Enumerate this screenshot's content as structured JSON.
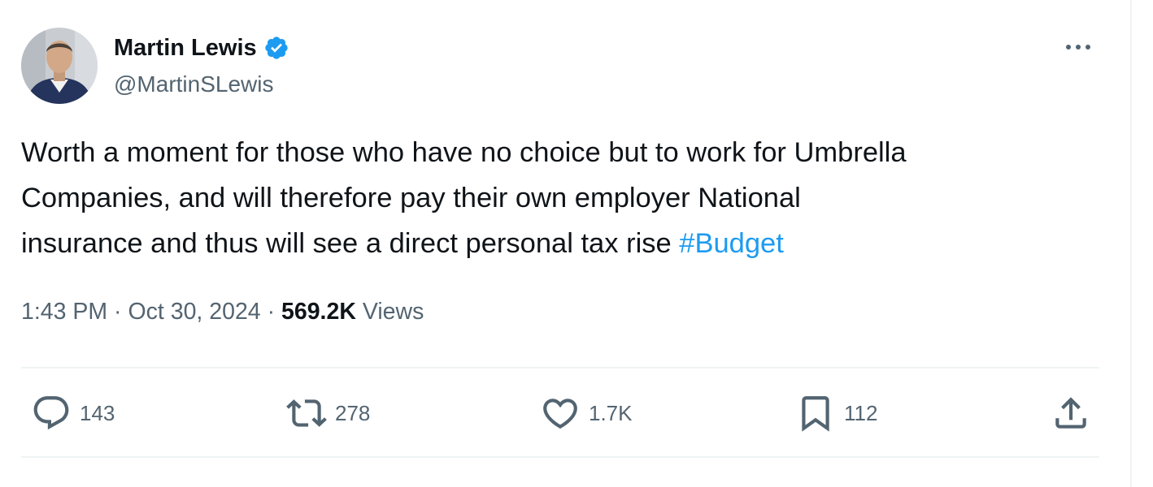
{
  "tweet": {
    "author": {
      "display_name": "Martin Lewis",
      "handle": "@MartinSLewis",
      "verified": true
    },
    "text_line_1": "Worth a moment for those who have no choice but to work for Umbrella",
    "text_line_2": "Companies, and will therefore pay their own employer National",
    "text_line_3": "insurance and thus will see a direct personal tax rise ",
    "hashtag": "#Budget",
    "time": "1:43 PM",
    "separator": " · ",
    "date": "Oct 30, 2024",
    "views_count": "569.2K",
    "views_label": " Views"
  },
  "actions": {
    "replies": "143",
    "reposts": "278",
    "likes": "1.7K",
    "bookmarks": "112"
  },
  "icons": {
    "verified": "verified-badge-icon",
    "more": "more-icon",
    "reply": "reply-icon",
    "repost": "repost-icon",
    "like": "heart-icon",
    "bookmark": "bookmark-icon",
    "share": "share-icon"
  },
  "colors": {
    "accent": "#1d9bf0",
    "text": "#0f1419",
    "muted": "#536471",
    "divider": "#eff3f4"
  }
}
